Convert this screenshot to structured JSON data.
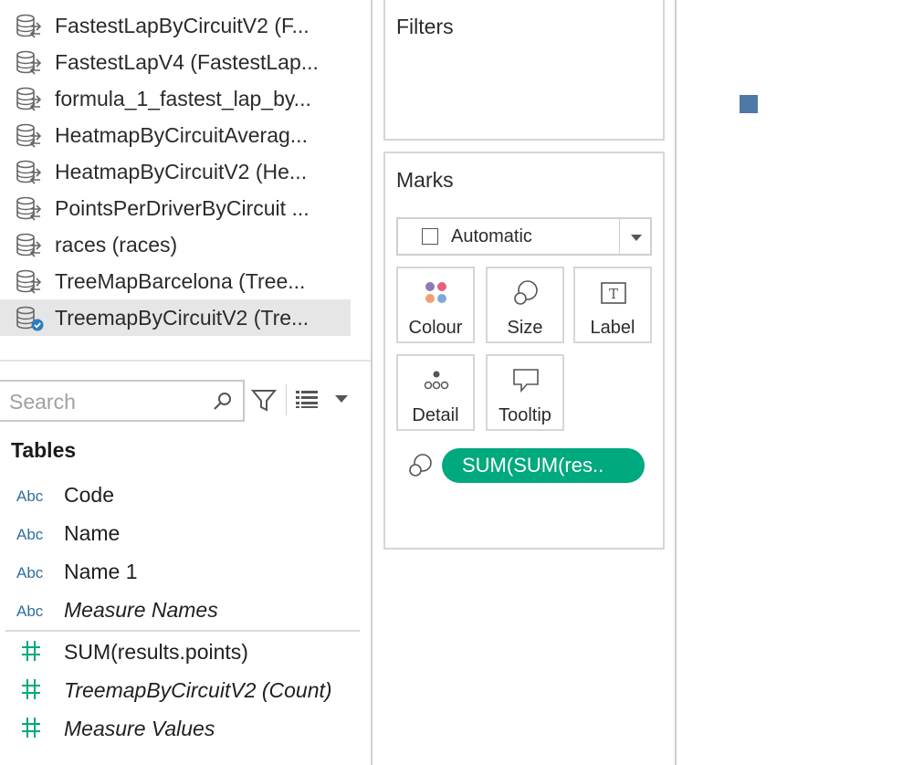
{
  "data_sources": [
    {
      "label": "FastestLapByCircuitV2 (F...",
      "selected": false
    },
    {
      "label": "FastestLapV4 (FastestLap...",
      "selected": false
    },
    {
      "label": "formula_1_fastest_lap_by...",
      "selected": false
    },
    {
      "label": "HeatmapByCircuitAverag...",
      "selected": false
    },
    {
      "label": "HeatmapByCircuitV2 (He...",
      "selected": false
    },
    {
      "label": "PointsPerDriverByCircuit ...",
      "selected": false
    },
    {
      "label": "races (races)",
      "selected": false
    },
    {
      "label": "TreeMapBarcelona (Tree...",
      "selected": false
    },
    {
      "label": "TreemapByCircuitV2 (Tre...",
      "selected": true
    }
  ],
  "search": {
    "placeholder": "Search",
    "value": ""
  },
  "tables_heading": "Tables",
  "fields": {
    "dimensions": [
      {
        "type": "Abc",
        "name": "Code"
      },
      {
        "type": "Abc",
        "name": "Name"
      },
      {
        "type": "Abc",
        "name": "Name 1"
      },
      {
        "type": "Abc",
        "name": "Measure Names"
      }
    ],
    "measures": [
      {
        "type": "#",
        "name": "SUM(results.points)"
      },
      {
        "type": "#",
        "name": "TreemapByCircuitV2 (Count)"
      },
      {
        "type": "#",
        "name": "Measure Values"
      }
    ]
  },
  "filters": {
    "title": "Filters"
  },
  "marks": {
    "title": "Marks",
    "mark_type": "Automatic",
    "buttons": {
      "colour": "Colour",
      "size": "Size",
      "label": "Label",
      "detail": "Detail",
      "tooltip": "Tooltip"
    },
    "size_pill": "SUM(SUM(res.."
  },
  "colors": {
    "pill": "#00a97e",
    "mark": "#4e79a7",
    "abc_icon": "#2f6f9f",
    "measure_icon": "#00a97e",
    "selected_row": "#e6e6e6"
  }
}
